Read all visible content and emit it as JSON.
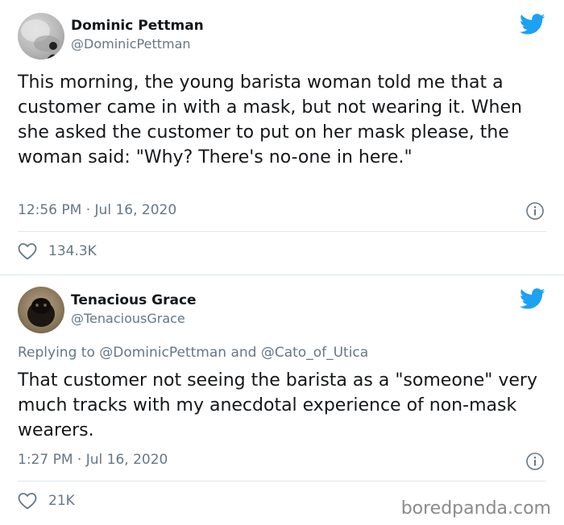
{
  "tweets": [
    {
      "author_name": "Dominic Pettman",
      "handle": "@DominicPettman",
      "body": "This morning, the young barista woman told me that a customer came in with a mask, but not wearing it. When she asked the customer to put on her mask please, the woman said: \"Why? There's no-one in here.\"",
      "timestamp": "12:56 PM · Jul 16, 2020",
      "likes": "134.3K",
      "avatar_icon": "user-avatar",
      "bird_icon": "twitter-bird-icon",
      "info_icon": "info-icon",
      "heart_icon": "heart-icon"
    },
    {
      "author_name": "Tenacious Grace",
      "handle": "@TenaciousGrace",
      "reply_to": "Replying to @DominicPettman and @Cato_of_Utica",
      "body": "That customer not seeing the barista as a \"someone\" very much tracks with my anecdotal experience of non-mask wearers.",
      "timestamp": "1:27 PM · Jul 16, 2020",
      "likes": "21K",
      "avatar_icon": "user-avatar",
      "bird_icon": "twitter-bird-icon",
      "info_icon": "info-icon",
      "heart_icon": "heart-icon"
    }
  ],
  "watermark": "boredpanda.com",
  "colors": {
    "twitter_blue": "#1da1f2",
    "text_primary": "#14171a",
    "text_secondary": "#657786",
    "divider": "#e1e8ed"
  }
}
